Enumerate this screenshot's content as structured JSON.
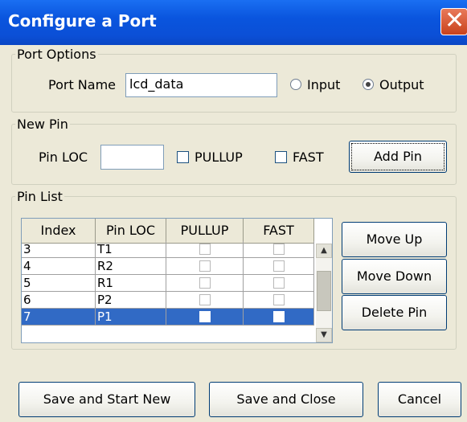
{
  "window": {
    "title": "Configure a Port"
  },
  "port_options": {
    "legend": "Port Options",
    "port_name_label": "Port Name",
    "port_name_value": "lcd_data",
    "input_label": "Input",
    "output_label": "Output",
    "selected": "Output"
  },
  "new_pin": {
    "legend": "New Pin",
    "pin_loc_label": "Pin LOC",
    "pin_loc_value": "",
    "pullup_label": "PULLUP",
    "fast_label": "FAST",
    "add_pin_label": "Add Pin"
  },
  "pin_list": {
    "legend": "Pin List",
    "columns": [
      "Index",
      "Pin LOC",
      "PULLUP",
      "FAST"
    ],
    "rows": [
      {
        "index": "3",
        "pin_loc": "T1",
        "pullup": false,
        "fast": false
      },
      {
        "index": "4",
        "pin_loc": "R2",
        "pullup": false,
        "fast": false
      },
      {
        "index": "5",
        "pin_loc": "R1",
        "pullup": false,
        "fast": false
      },
      {
        "index": "6",
        "pin_loc": "P2",
        "pullup": false,
        "fast": false
      },
      {
        "index": "7",
        "pin_loc": "P1",
        "pullup": false,
        "fast": false
      }
    ],
    "selected_index": "7",
    "move_up_label": "Move Up",
    "move_down_label": "Move Down",
    "delete_pin_label": "Delete Pin"
  },
  "footer": {
    "save_new_label": "Save and Start New",
    "save_close_label": "Save and Close",
    "cancel_label": "Cancel"
  },
  "colors": {
    "titlebar": "#0a55de",
    "selection": "#316ac5",
    "dialog_bg": "#ece9d8"
  }
}
